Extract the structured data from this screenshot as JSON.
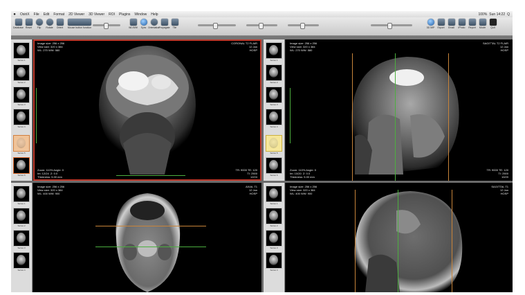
{
  "menubar": {
    "apple": "",
    "items": [
      "OsiriX",
      "File",
      "Edit",
      "Format",
      "2D Viewer",
      "3D Viewer",
      "ROI",
      "Plugins",
      "Window",
      "Help"
    ],
    "right": [
      "100%",
      "Sun 14:22",
      "Q"
    ]
  },
  "toolbar": {
    "left_buttons": [
      "Database",
      "Reset",
      "Flip",
      "Rotate",
      "Orient",
      "Mouse button function"
    ],
    "mid_buttons": [
      "WL/WW",
      "Sync",
      "Orientation",
      "Propagate",
      "Tile"
    ],
    "right_buttons": [
      "3D MIP",
      "Export",
      "Email",
      "iPhoto",
      "Report",
      "Movie",
      "Quit"
    ]
  },
  "viewers": [
    {
      "orientation": "coronal",
      "info_tl": "Image size: 256 x 256\nView size: 320 x 384\nWL: 270 WW: 580",
      "info_tr": "CORONAL T2 FLAIR\n12 Jan\nHOSP",
      "info_bl": "Zoom: 110% Angle: 0\nIm: 12/24  Z: 0.0\nThickness: 5.00 mm",
      "info_br": "TR: 9000 TE: 120\nTI: 2500\n12/24",
      "thumbs": [
        "Series 1",
        "Series 2",
        "Series 3",
        "Series 4",
        "Series 5",
        "Series 6"
      ]
    },
    {
      "orientation": "sagittal",
      "info_tl": "Image size: 256 x 256\nView size: 320 x 384\nWL: 270 WW: 580",
      "info_tr": "SAGITTAL T2 FLAIR\n12 Jan\nHOSP",
      "info_bl": "Zoom: 110% Angle: 0\nIm: 10/20  Z: 0.0\nThickness: 5.00 mm",
      "info_br": "TR: 9000 TE: 120\nTI: 2500\n10/20",
      "thumbs": [
        "Series 1",
        "Series 2",
        "Series 3",
        "Series 4",
        "Series 5",
        "Series 6"
      ]
    },
    {
      "orientation": "axial",
      "info_tl": "Image size: 256 x 256\nView size: 320 x 384\nWL: 400 WW: 900",
      "info_tr": "AXIAL T1\n12 Jan\nHOSP",
      "info_bl": "",
      "info_br": "",
      "thumbs": [
        "Series 1",
        "Series 2",
        "Series 3",
        "Series 4"
      ]
    },
    {
      "orientation": "sagittal-t1",
      "info_tl": "Image size: 256 x 256\nView size: 320 x 384\nWL: 400 WW: 900",
      "info_tr": "SAGITTAL T1\n12 Jan\nHOSP",
      "info_bl": "",
      "info_br": "",
      "thumbs": [
        "Series 1",
        "Series 2",
        "Series 3",
        "Series 4"
      ]
    }
  ],
  "colors": {
    "selection": "#c0392b",
    "crosshair_green": "#4caf3f",
    "crosshair_orange": "#c8843a"
  }
}
